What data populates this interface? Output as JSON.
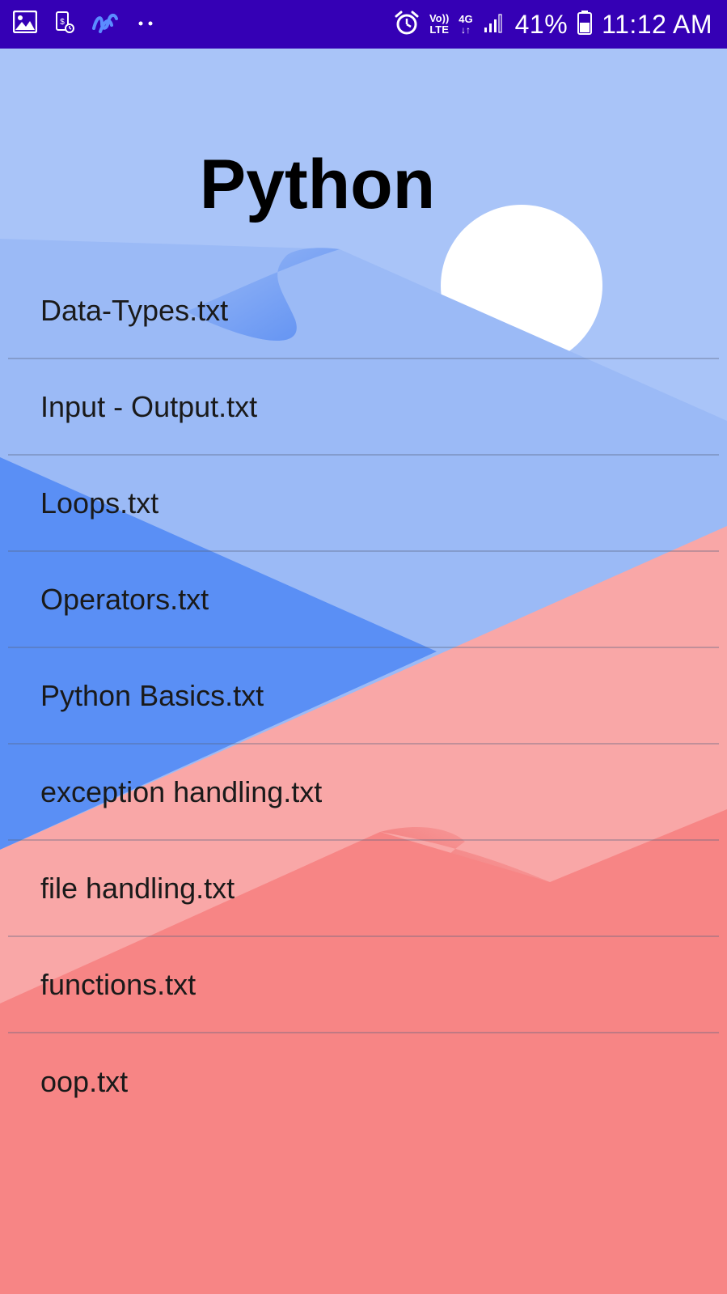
{
  "status_bar": {
    "left_icons": [
      "gallery-icon",
      "card-payment-icon",
      "app-logo-icon",
      "more-notifications-icon"
    ],
    "right_icons": [
      "alarm-icon",
      "volte-icon",
      "4g-icon",
      "signal-icon",
      "battery-icon"
    ],
    "volte_label_top": "Vo))",
    "volte_label_bottom": "LTE",
    "network_label": "4G",
    "battery_percent": "41%",
    "time": "11:12 AM",
    "background_color": "#3500b5"
  },
  "page": {
    "title": "Python"
  },
  "files": [
    {
      "label": "Data-Types.txt"
    },
    {
      "label": "Input - Output.txt"
    },
    {
      "label": "Loops.txt"
    },
    {
      "label": "Operators.txt"
    },
    {
      "label": "Python Basics.txt"
    },
    {
      "label": "exception handling.txt"
    },
    {
      "label": "file handling.txt"
    },
    {
      "label": "functions.txt"
    },
    {
      "label": "oop.txt"
    }
  ],
  "colors": {
    "sky": "#a9c4f8",
    "blue_hill": "#9bbaf6",
    "deep_blue": "#5a8ff5",
    "pink": "#f9a7a7",
    "red": "#f78585",
    "sun": "#ffffff"
  }
}
